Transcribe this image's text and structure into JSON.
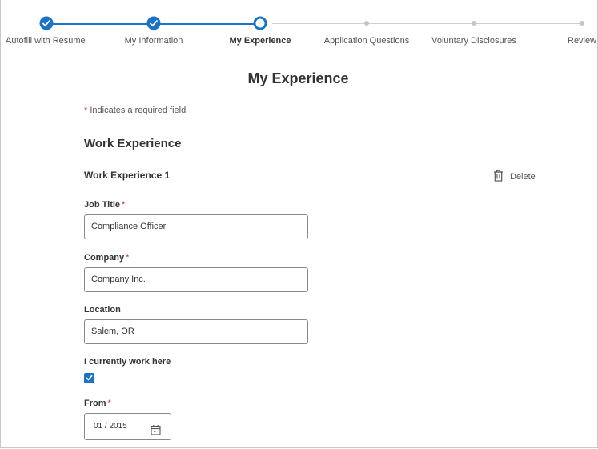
{
  "progress": {
    "steps": [
      {
        "label": "Autofill with Resume",
        "state": "done"
      },
      {
        "label": "My Information",
        "state": "done"
      },
      {
        "label": "My Experience",
        "state": "current"
      },
      {
        "label": "Application Questions",
        "state": "todo"
      },
      {
        "label": "Voluntary Disclosures",
        "state": "todo"
      },
      {
        "label": "Review",
        "state": "todo"
      }
    ],
    "accent_color": "#1a73c7"
  },
  "page": {
    "title": "My Experience",
    "required_star": "*",
    "required_note": " Indicates a required field",
    "section_heading": "Work Experience",
    "entry_heading": "Work Experience 1",
    "delete_label": "Delete"
  },
  "form": {
    "job_title": {
      "label": "Job Title",
      "value": "Compliance Officer",
      "required": true
    },
    "company": {
      "label": "Company",
      "value": "Company Inc.",
      "required": true
    },
    "location": {
      "label": "Location",
      "value": "Salem, OR"
    },
    "currently_work_here": {
      "label": "I currently work here",
      "checked": true
    },
    "from": {
      "label": "From",
      "value": "01 / 2015",
      "required": true
    }
  }
}
